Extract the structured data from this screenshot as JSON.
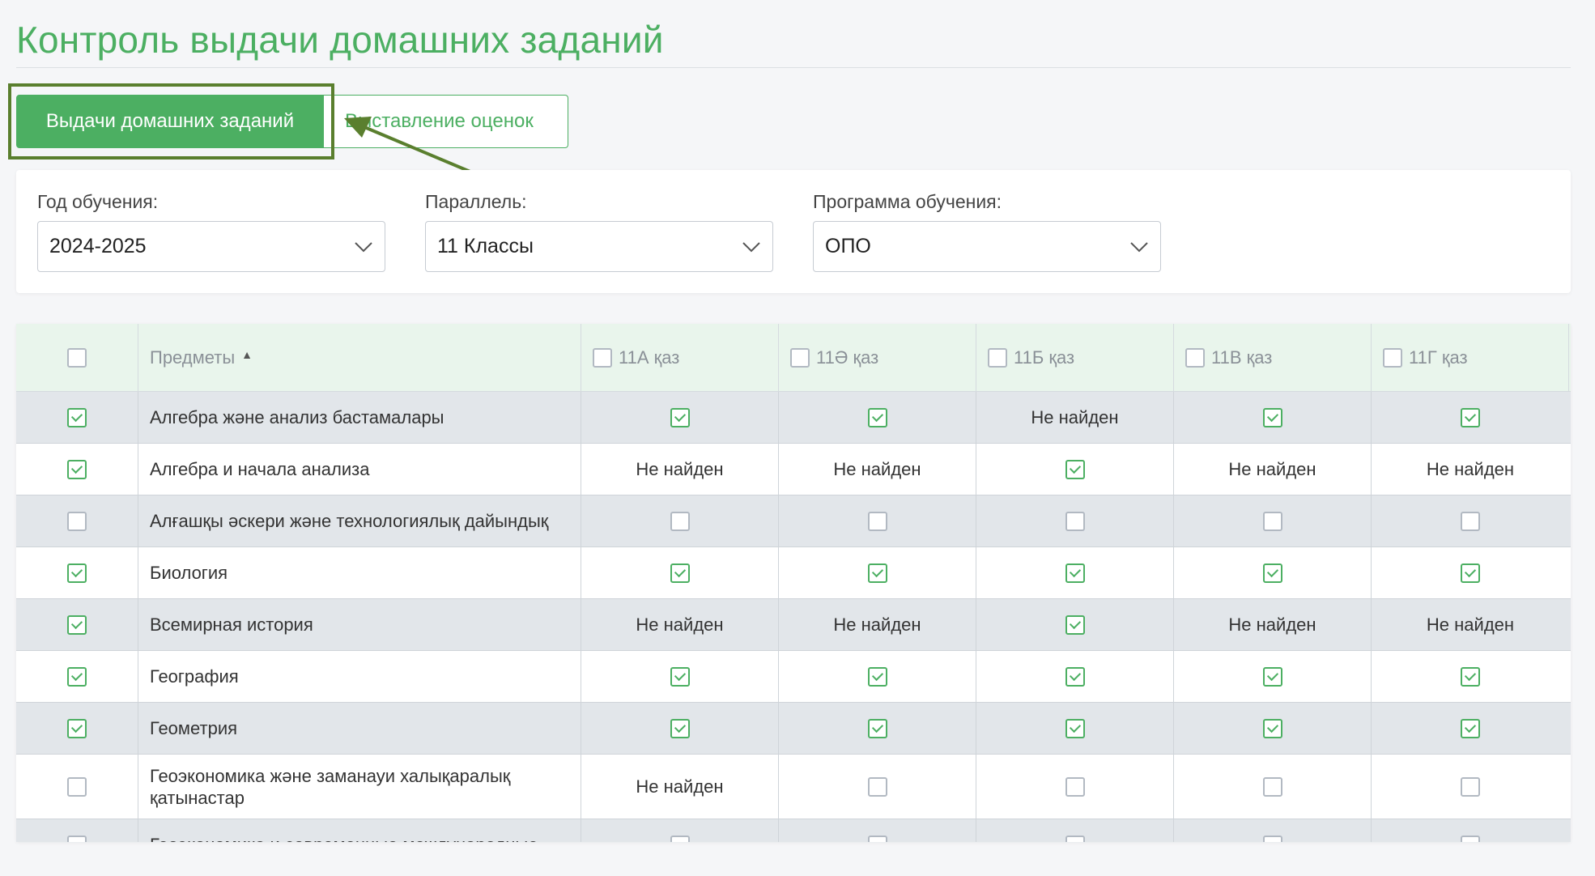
{
  "page": {
    "title": "Контроль выдачи домашних заданий"
  },
  "tabs": [
    {
      "label": "Выдачи домашних заданий",
      "active": true
    },
    {
      "label": "Выставление оценок",
      "active": false
    }
  ],
  "filters": [
    {
      "label": "Год обучения:",
      "value": "2024-2025"
    },
    {
      "label": "Параллель:",
      "value": "11 Классы"
    },
    {
      "label": "Программа обучения:",
      "value": "ОПО"
    }
  ],
  "table": {
    "subject_header": "Предметы",
    "classes": [
      "11А қаз",
      "11Ә қаз",
      "11Б қаз",
      "11В қаз",
      "11Г қаз"
    ],
    "not_found_text": "Не найден",
    "rows": [
      {
        "subject": "Алгебра және анализ бастамалары",
        "checked": true,
        "cells": [
          "checked",
          "checked",
          "not_found",
          "checked",
          "checked"
        ]
      },
      {
        "subject": "Алгебра и начала анализа",
        "checked": true,
        "cells": [
          "not_found",
          "not_found",
          "checked",
          "not_found",
          "not_found"
        ]
      },
      {
        "subject": "Алғашқы әскери және технологиялық дайындық",
        "checked": false,
        "cells": [
          "unchecked",
          "unchecked",
          "unchecked",
          "unchecked",
          "unchecked"
        ]
      },
      {
        "subject": "Биология",
        "checked": true,
        "cells": [
          "checked",
          "checked",
          "checked",
          "checked",
          "checked"
        ]
      },
      {
        "subject": "Всемирная история",
        "checked": true,
        "cells": [
          "not_found",
          "not_found",
          "checked",
          "not_found",
          "not_found"
        ]
      },
      {
        "subject": "География",
        "checked": true,
        "cells": [
          "checked",
          "checked",
          "checked",
          "checked",
          "checked"
        ]
      },
      {
        "subject": "Геометрия",
        "checked": true,
        "cells": [
          "checked",
          "checked",
          "checked",
          "checked",
          "checked"
        ]
      },
      {
        "subject": "Геоэкономика және заманауи халықаралық қатынастар",
        "checked": false,
        "cells": [
          "not_found",
          "unchecked",
          "unchecked",
          "unchecked",
          "unchecked"
        ]
      },
      {
        "subject": "Геоэкономика и современные международные",
        "checked": false,
        "cells": [
          "unchecked",
          "unchecked",
          "unchecked",
          "unchecked",
          "unchecked"
        ]
      }
    ]
  },
  "colors": {
    "accent": "#4caf62",
    "highlight_border": "#5a7f2e",
    "annotation_arrow": "#5a7f2e"
  }
}
